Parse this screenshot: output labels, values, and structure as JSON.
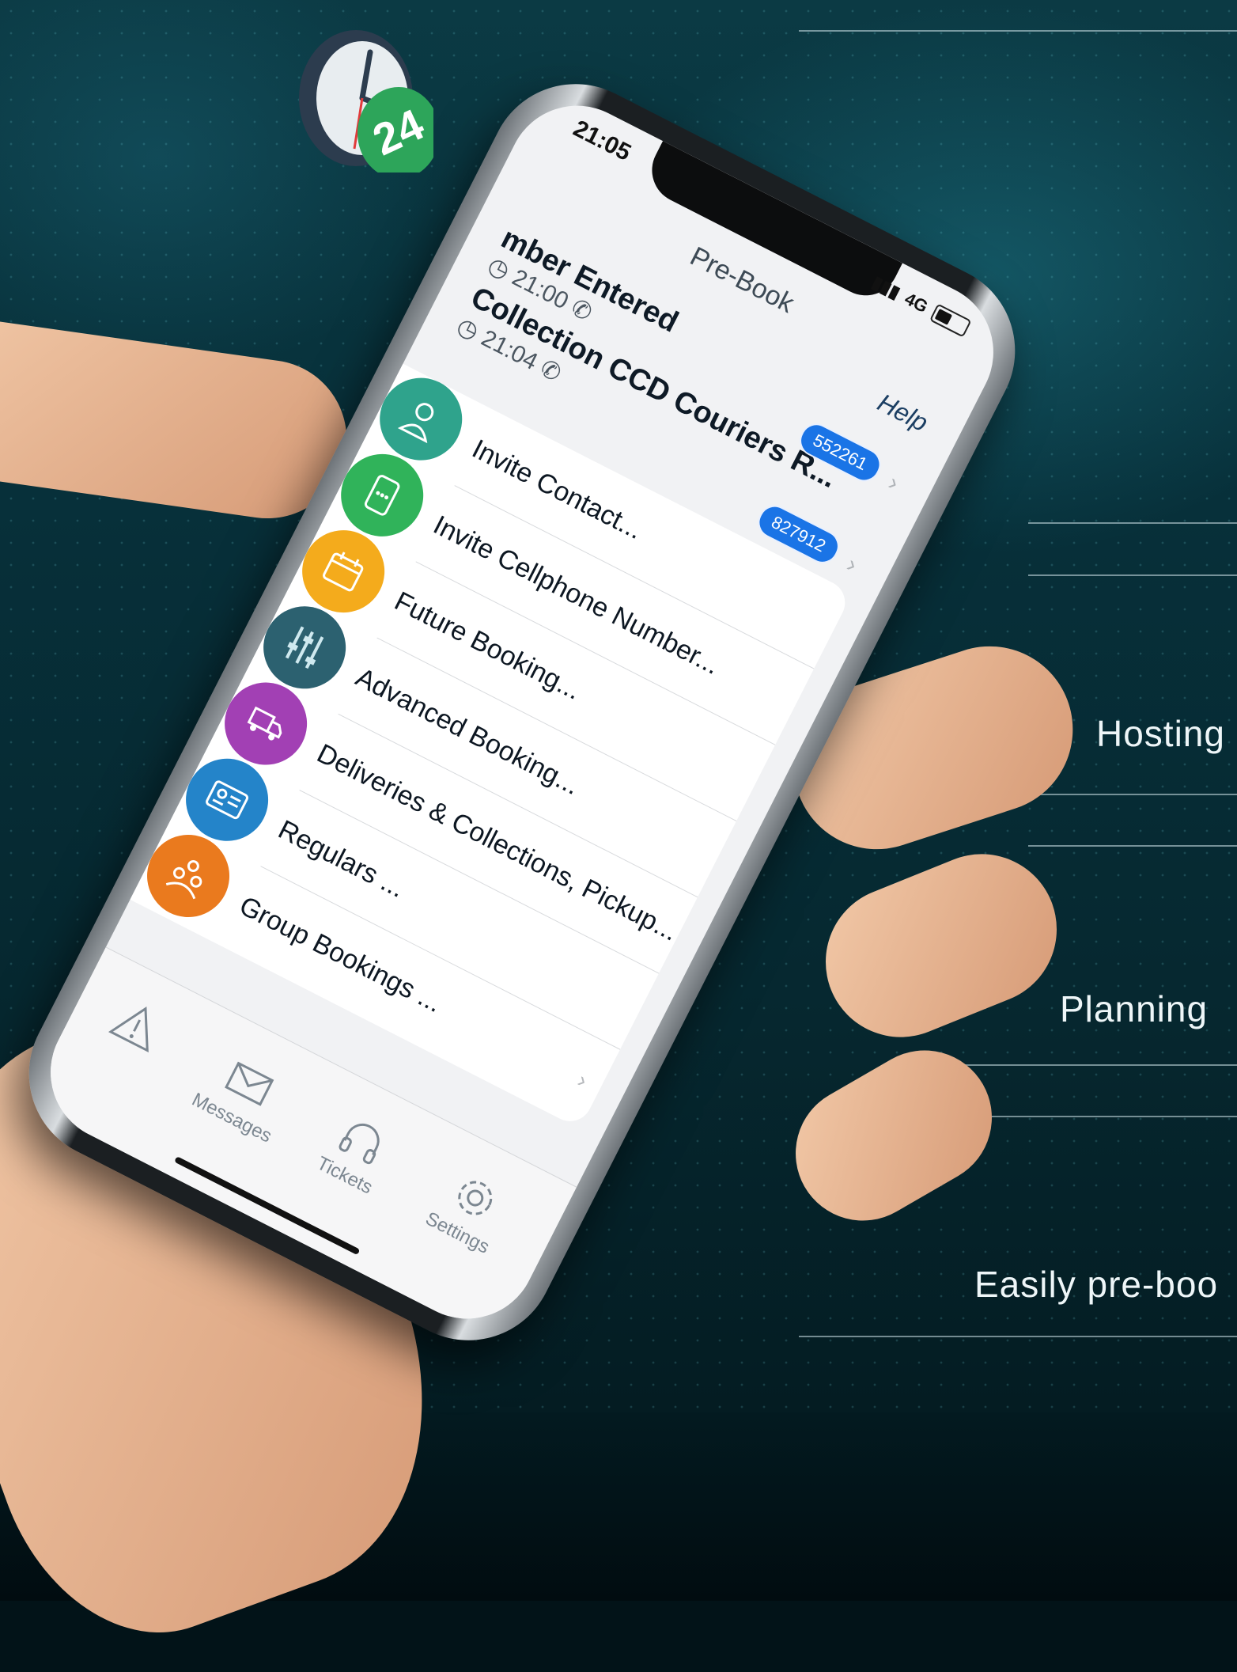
{
  "side_texts": {
    "hosting": "Hosting",
    "planning": "Planning",
    "easily": "Easily pre-boo"
  },
  "status_bar": {
    "time": "21:05",
    "network": "4G"
  },
  "nav": {
    "title": "Pre-Book",
    "help": "Help"
  },
  "calls": [
    {
      "title": "mber Entered",
      "time": "21:00"
    },
    {
      "title": "Collection CCD Couriers  R...",
      "time": "21:04",
      "badge": "552261"
    }
  ],
  "second_badge": "827912",
  "menu": [
    {
      "label": "Invite Contact...",
      "color": "#2fa38c",
      "icon": "contact-icon"
    },
    {
      "label": "Invite Cellphone Number...",
      "color": "#30b35a",
      "icon": "cellphone-icon"
    },
    {
      "label": "Future Booking...",
      "color": "#f4ab1c",
      "icon": "calendar-icon"
    },
    {
      "label": "Advanced Booking...",
      "color": "#2c6170",
      "icon": "sliders-icon"
    },
    {
      "label": "Deliveries & Collections, Pickup...",
      "color": "#a240b4",
      "icon": "truck-icon"
    },
    {
      "label": "Regulars ...",
      "color": "#2484c9",
      "icon": "id-card-icon"
    },
    {
      "label": "Group Bookings ...",
      "color": "#ea7a1e",
      "icon": "group-icon"
    }
  ],
  "tabs": {
    "messages": "Messages",
    "tickets": "Tickets",
    "settings": "Settings"
  },
  "sticker": {
    "number": "24"
  },
  "colors": {
    "accent": "#1a74e6",
    "background": "#0b3a44"
  }
}
